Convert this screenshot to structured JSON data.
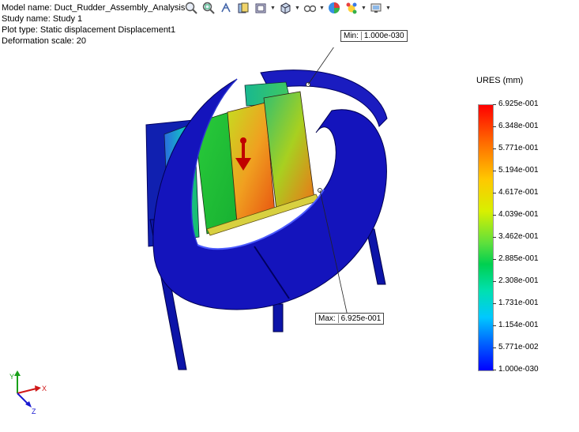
{
  "info": {
    "model": "Model name: Duct_Rudder_Assembly_Analysis",
    "study": "Study name: Study 1",
    "plot": "Plot type: Static displacement Displacement1",
    "scale": "Deformation scale: 20"
  },
  "toolbar": [
    {
      "icon": "zoom-to-fit-icon",
      "dropdown": false
    },
    {
      "icon": "zoom-to-area-icon",
      "dropdown": false
    },
    {
      "icon": "previous-view-icon",
      "dropdown": false
    },
    {
      "icon": "section-view-icon",
      "dropdown": false
    },
    {
      "icon": "view-orientation-icon",
      "dropdown": true
    },
    {
      "icon": "display-style-icon",
      "dropdown": true
    },
    {
      "icon": "hide-show-items-icon",
      "dropdown": true
    },
    {
      "icon": "edit-appearance-icon",
      "dropdown": false
    },
    {
      "icon": "apply-scene-icon",
      "dropdown": true
    },
    {
      "icon": "view-settings-icon",
      "dropdown": true
    }
  ],
  "callouts": {
    "min_label": "Min:",
    "min_value": "1.000e-030",
    "max_label": "Max:",
    "max_value": "6.925e-001"
  },
  "legend": {
    "title": "URES (mm)",
    "ticks": [
      "6.925e-001",
      "6.348e-001",
      "5.771e-001",
      "5.194e-001",
      "4.617e-001",
      "4.039e-001",
      "3.462e-001",
      "2.885e-001",
      "2.308e-001",
      "1.731e-001",
      "1.154e-001",
      "5.771e-002",
      "1.000e-030"
    ]
  },
  "triad": {
    "x": "X",
    "y": "Y",
    "z": "Z"
  },
  "colors": {
    "accent_red": "#ff0000",
    "model_blue": "#0a0ab4"
  }
}
